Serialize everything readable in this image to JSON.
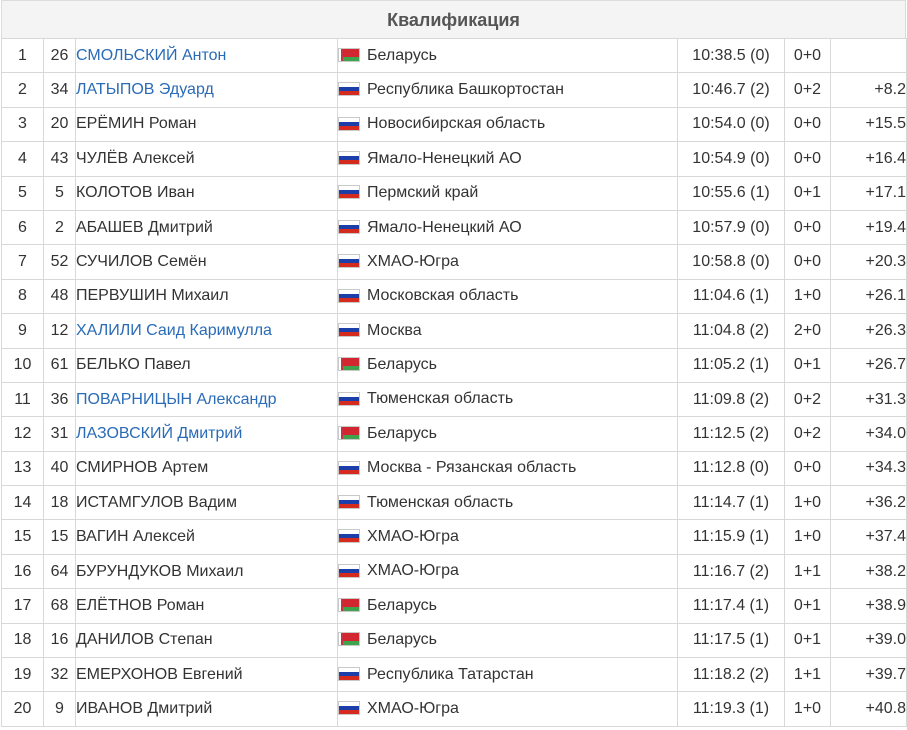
{
  "title": "Квалификация",
  "colors": {
    "link": "#2a6bb7",
    "text": "#333333",
    "muted": "#888888",
    "header_bg": "#f4f4f4"
  },
  "rows": [
    {
      "pos": "1",
      "bib": "26",
      "name": "СМОЛЬСКИЙ Антон",
      "linked": true,
      "flag": "by",
      "region": "Беларусь",
      "time": "10:38.5 (0)",
      "shooting": "0+0",
      "gap": ""
    },
    {
      "pos": "2",
      "bib": "34",
      "name": "ЛАТЫПОВ Эдуард",
      "linked": true,
      "flag": "ru",
      "region": "Республика Башкортостан",
      "time": "10:46.7 (2)",
      "shooting": "0+2",
      "gap": "+8.2"
    },
    {
      "pos": "3",
      "bib": "20",
      "name": "ЕРЁМИН Роман",
      "linked": false,
      "flag": "ru",
      "region": "Новосибирская область",
      "time": "10:54.0 (0)",
      "shooting": "0+0",
      "gap": "+15.5"
    },
    {
      "pos": "4",
      "bib": "43",
      "name": "ЧУЛЁВ Алексей",
      "linked": false,
      "flag": "ru",
      "region": "Ямало-Ненецкий АО",
      "time": "10:54.9 (0)",
      "shooting": "0+0",
      "gap": "+16.4"
    },
    {
      "pos": "5",
      "bib": "5",
      "name": "КОЛОТОВ Иван",
      "linked": false,
      "flag": "ru",
      "region": "Пермский край",
      "time": "10:55.6 (1)",
      "shooting": "0+1",
      "gap": "+17.1"
    },
    {
      "pos": "6",
      "bib": "2",
      "name": "АБАШЕВ Дмитрий",
      "linked": false,
      "flag": "ru",
      "region": "Ямало-Ненецкий АО",
      "time": "10:57.9 (0)",
      "shooting": "0+0",
      "gap": "+19.4"
    },
    {
      "pos": "7",
      "bib": "52",
      "name": "СУЧИЛОВ Семён",
      "linked": false,
      "flag": "ru",
      "region": "ХМАО-Югра",
      "time": "10:58.8 (0)",
      "shooting": "0+0",
      "gap": "+20.3"
    },
    {
      "pos": "8",
      "bib": "48",
      "name": "ПЕРВУШИН Михаил",
      "linked": false,
      "flag": "ru",
      "region": "Московская область",
      "time": "11:04.6 (1)",
      "shooting": "1+0",
      "gap": "+26.1"
    },
    {
      "pos": "9",
      "bib": "12",
      "name": "ХАЛИЛИ Саид Каримулла",
      "linked": true,
      "flag": "ru",
      "region": "Москва",
      "time": "11:04.8 (2)",
      "shooting": "2+0",
      "gap": "+26.3"
    },
    {
      "pos": "10",
      "bib": "61",
      "name": "БЕЛЬКО Павел",
      "linked": false,
      "flag": "by",
      "region": "Беларусь",
      "time": "11:05.2 (1)",
      "shooting": "0+1",
      "gap": "+26.7"
    },
    {
      "pos": "11",
      "bib": "36",
      "name": "ПОВАРНИЦЫН Александр",
      "linked": true,
      "flag": "ru",
      "region": "Тюменская область",
      "time": "11:09.8 (2)",
      "shooting": "0+2",
      "gap": "+31.3"
    },
    {
      "pos": "12",
      "bib": "31",
      "name": "ЛАЗОВСКИЙ Дмитрий",
      "linked": true,
      "flag": "by",
      "region": "Беларусь",
      "time": "11:12.5 (2)",
      "shooting": "0+2",
      "gap": "+34.0"
    },
    {
      "pos": "13",
      "bib": "40",
      "name": "СМИРНОВ Артем",
      "linked": false,
      "flag": "ru",
      "region": "Москва - Рязанская область",
      "time": "11:12.8 (0)",
      "shooting": "0+0",
      "gap": "+34.3"
    },
    {
      "pos": "14",
      "bib": "18",
      "name": "ИСТАМГУЛОВ Вадим",
      "linked": false,
      "flag": "ru",
      "region": "Тюменская область",
      "time": "11:14.7 (1)",
      "shooting": "1+0",
      "gap": "+36.2"
    },
    {
      "pos": "15",
      "bib": "15",
      "name": "ВАГИН Алексей",
      "linked": false,
      "flag": "ru",
      "region": "ХМАО-Югра",
      "time": "11:15.9 (1)",
      "shooting": "1+0",
      "gap": "+37.4"
    },
    {
      "pos": "16",
      "bib": "64",
      "name": "БУРУНДУКОВ Михаил",
      "linked": false,
      "flag": "ru",
      "region": "ХМАО-Югра",
      "time": "11:16.7 (2)",
      "shooting": "1+1",
      "gap": "+38.2"
    },
    {
      "pos": "17",
      "bib": "68",
      "name": "ЕЛЁТНОВ Роман",
      "linked": false,
      "flag": "by",
      "region": "Беларусь",
      "time": "11:17.4 (1)",
      "shooting": "0+1",
      "gap": "+38.9"
    },
    {
      "pos": "18",
      "bib": "16",
      "name": "ДАНИЛОВ Степан",
      "linked": false,
      "flag": "by",
      "region": "Беларусь",
      "time": "11:17.5 (1)",
      "shooting": "0+1",
      "gap": "+39.0"
    },
    {
      "pos": "19",
      "bib": "32",
      "name": "ЕМЕРХОНОВ Евгений",
      "linked": false,
      "flag": "ru",
      "region": "Республика Татарстан",
      "time": "11:18.2 (2)",
      "shooting": "1+1",
      "gap": "+39.7"
    },
    {
      "pos": "20",
      "bib": "9",
      "name": "ИВАНОВ Дмитрий",
      "linked": false,
      "flag": "ru",
      "region": "ХМАО-Югра",
      "time": "11:19.3 (1)",
      "shooting": "1+0",
      "gap": "+40.8"
    }
  ]
}
